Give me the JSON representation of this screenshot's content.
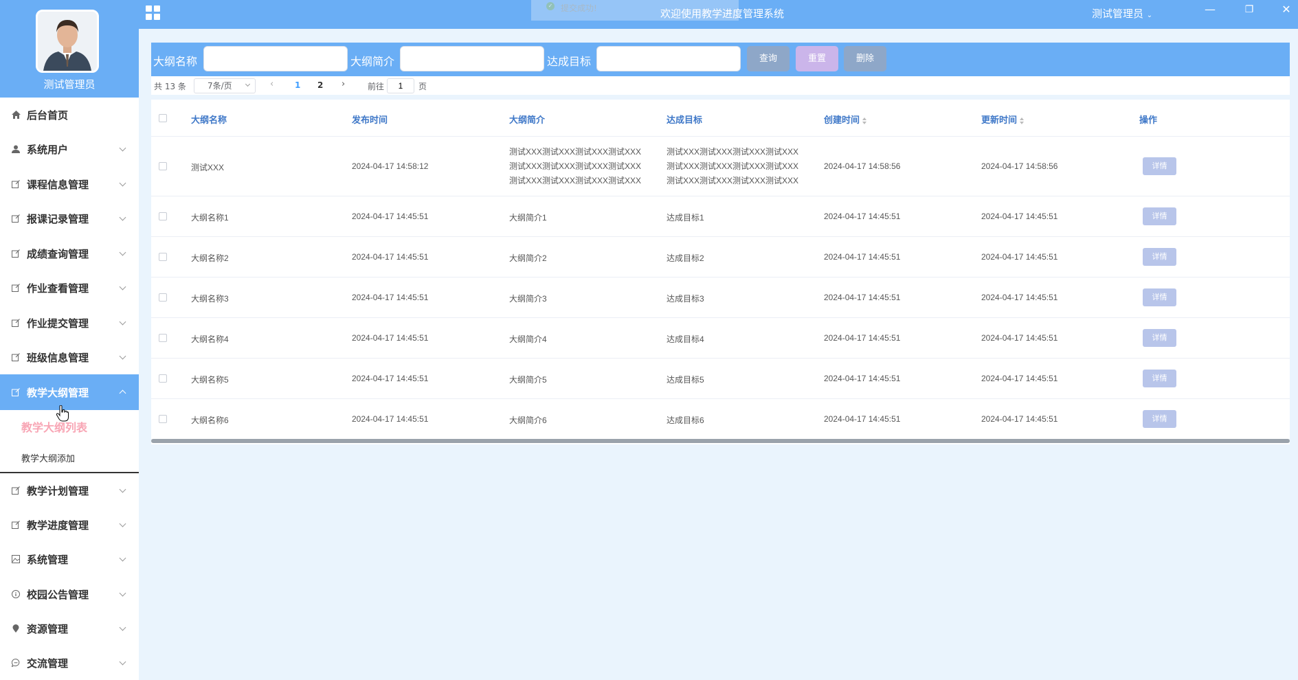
{
  "sidebar": {
    "user_name": "测试管理员",
    "menu": [
      {
        "label": "后台首页",
        "icon": "home-icon"
      },
      {
        "label": "系统用户",
        "icon": "user-icon"
      },
      {
        "label": "课程信息管理",
        "icon": "edit-icon"
      },
      {
        "label": "报课记录管理",
        "icon": "edit-icon"
      },
      {
        "label": "成绩查询管理",
        "icon": "edit-icon"
      },
      {
        "label": "作业查看管理",
        "icon": "edit-icon"
      },
      {
        "label": "作业提交管理",
        "icon": "edit-icon"
      },
      {
        "label": "班级信息管理",
        "icon": "edit-icon"
      },
      {
        "label": "教学大纲管理",
        "icon": "edit-icon"
      },
      {
        "label": "教学计划管理",
        "icon": "edit-icon"
      },
      {
        "label": "教学进度管理",
        "icon": "edit-icon"
      },
      {
        "label": "系统管理",
        "icon": "image-icon"
      },
      {
        "label": "校园公告管理",
        "icon": "info-icon"
      },
      {
        "label": "资源管理",
        "icon": "pin-icon"
      },
      {
        "label": "交流管理",
        "icon": "chat-icon"
      }
    ],
    "submenu": [
      {
        "label": "教学大纲列表"
      },
      {
        "label": "教学大纲添加"
      }
    ]
  },
  "topbar": {
    "toast": "提交成功!",
    "title": "欢迎使用教学进度管理系统",
    "user": "测试管理员",
    "dropdown_glyph": "⌄",
    "minimize": "—",
    "restore": "❐",
    "close": "✕"
  },
  "search": {
    "name_label": "大纲名称",
    "intro_label": "大纲简介",
    "goal_label": "达成目标",
    "query": "查询",
    "reset": "重置",
    "delete": "删除"
  },
  "pagination": {
    "total": "共 13 条",
    "page_size": "7条/页",
    "prev": "‹",
    "pages": [
      "1",
      "2"
    ],
    "next": "›",
    "goto_label": "前往",
    "goto_value": "1",
    "goto_unit": "页"
  },
  "table": {
    "headers": [
      "大纲名称",
      "发布时间",
      "大纲简介",
      "达成目标",
      "创建时间",
      "更新时间",
      "操作"
    ],
    "detail_label": "详情",
    "rows": [
      {
        "name": "测试XXX",
        "publish": "2024-04-17 14:58:12",
        "intro": [
          "测试XXX测试XXX测试XXX测试XXX",
          "测试XXX测试XXX测试XXX测试XXX",
          "测试XXX测试XXX测试XXX测试XXX"
        ],
        "goal": [
          "测试XXX测试XXX测试XXX测试XXX",
          "测试XXX测试XXX测试XXX测试XXX",
          "测试XXX测试XXX测试XXX测试XXX"
        ],
        "created": "2024-04-17 14:58:56",
        "updated": "2024-04-17 14:58:56"
      },
      {
        "name": "大纲名称1",
        "publish": "2024-04-17 14:45:51",
        "intro": [
          "大纲简介1"
        ],
        "goal": [
          "达成目标1"
        ],
        "created": "2024-04-17 14:45:51",
        "updated": "2024-04-17 14:45:51"
      },
      {
        "name": "大纲名称2",
        "publish": "2024-04-17 14:45:51",
        "intro": [
          "大纲简介2"
        ],
        "goal": [
          "达成目标2"
        ],
        "created": "2024-04-17 14:45:51",
        "updated": "2024-04-17 14:45:51"
      },
      {
        "name": "大纲名称3",
        "publish": "2024-04-17 14:45:51",
        "intro": [
          "大纲简介3"
        ],
        "goal": [
          "达成目标3"
        ],
        "created": "2024-04-17 14:45:51",
        "updated": "2024-04-17 14:45:51"
      },
      {
        "name": "大纲名称4",
        "publish": "2024-04-17 14:45:51",
        "intro": [
          "大纲简介4"
        ],
        "goal": [
          "达成目标4"
        ],
        "created": "2024-04-17 14:45:51",
        "updated": "2024-04-17 14:45:51"
      },
      {
        "name": "大纲名称5",
        "publish": "2024-04-17 14:45:51",
        "intro": [
          "大纲简介5"
        ],
        "goal": [
          "达成目标5"
        ],
        "created": "2024-04-17 14:45:51",
        "updated": "2024-04-17 14:45:51"
      },
      {
        "name": "大纲名称6",
        "publish": "2024-04-17 14:45:51",
        "intro": [
          "大纲简介6"
        ],
        "goal": [
          "达成目标6"
        ],
        "created": "2024-04-17 14:45:51",
        "updated": "2024-04-17 14:45:51"
      }
    ]
  },
  "colors": {
    "primary": "#6aaef5",
    "active_sub": "#f8a6b5",
    "header_text": "#3f78c8"
  }
}
